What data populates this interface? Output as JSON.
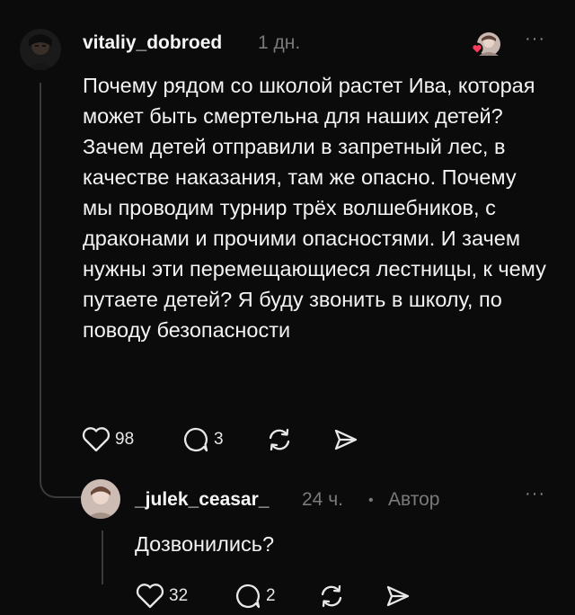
{
  "post": {
    "username": "vitaliy_dobroed",
    "time": "1 дн.",
    "text": "Почему рядом со школой растет Ива, которая может быть смертельна для наших детей? Зачем  детей отправили в запретный лес, в качестве наказания, там же опасно. Почему мы проводим турнир трёх волшебников, с драконами и прочими опасностями. И зачем нужны эти перемещающиеся лестницы, к чему путаете детей? Я буду звонить в школу, по поводу безопасности",
    "likes": "98",
    "comments": "3",
    "more": "···"
  },
  "reply": {
    "username": "_julek_ceasar_",
    "time": "24 ч.",
    "separator": "•",
    "badge": "Автор",
    "text": "Дозвонились?",
    "likes": "32",
    "comments": "2",
    "more": "···"
  },
  "colors": {
    "background": "#0b0b0b",
    "text": "#f3f3f3",
    "muted": "#7a7a7a",
    "like_heart": "#ff3b5c"
  },
  "icons": {
    "like": "heart-icon",
    "comment": "comment-bubble-icon",
    "repost": "repost-icon",
    "share": "send-icon"
  }
}
